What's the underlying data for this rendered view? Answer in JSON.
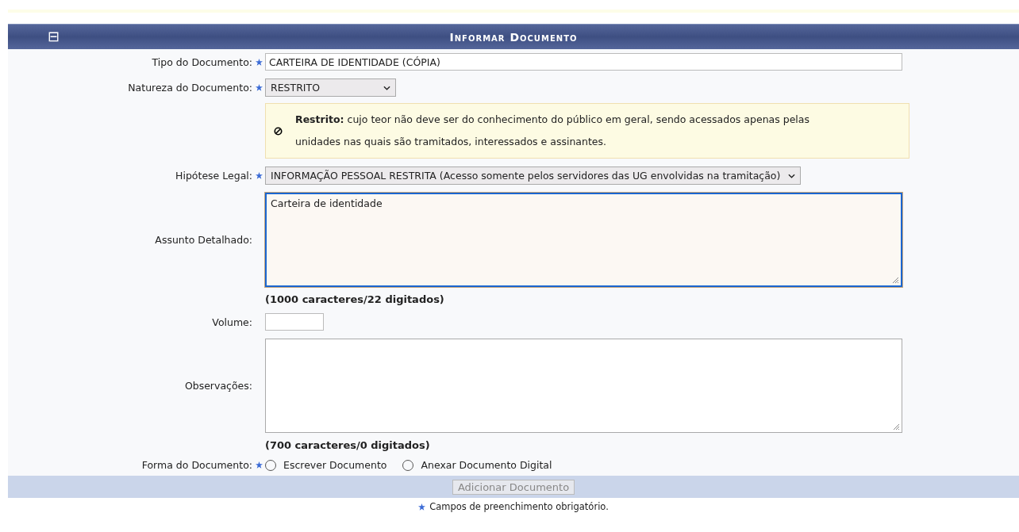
{
  "panel": {
    "title": "Informar Documento",
    "collapse_icon": "⊟"
  },
  "fields": [
    {
      "kind": "input",
      "label": "Tipo do Documento:",
      "required": true,
      "value": "CARTEIRA DE IDENTIDADE (CÓPIA)"
    },
    {
      "kind": "select",
      "label": "Natureza do Documento:",
      "required": true,
      "value": "RESTRITO"
    },
    {
      "kind": "note",
      "text": "**Restrito:** cujo teor não deve ser do conhecimento do público em geral, sendo acessados apenas pelas unidades nas quais são tramitados, interessados e assinantes."
    },
    {
      "kind": "select",
      "label": "Hipótese Legal:",
      "required": true,
      "value": "INFORMAÇÃO PESSOAL RESTRITA (Acesso somente pelos servidores das UG envolvidas na tramitação)"
    },
    {
      "kind": "textarea",
      "label": "Assunto Detalhado:",
      "required": false,
      "value": "Carteira de identidade",
      "focused": true
    },
    {
      "kind": "counter",
      "text": "(1000 caracteres/22 digitados)"
    },
    {
      "kind": "input",
      "label": "Volume:",
      "required": false
    },
    {
      "kind": "textarea",
      "label": "Observações:",
      "required": false,
      "focused": false
    },
    {
      "kind": "counter",
      "text": "(700 caracteres/0 digitados)"
    },
    {
      "kind": "radios",
      "label": "Forma do Documento:",
      "required": true,
      "options": [
        {
          "label": "Escrever Documento",
          "selected": false
        },
        {
          "label": "Anexar Documento Digital",
          "selected": false
        }
      ]
    }
  ],
  "button": {
    "label": "Adicionar Documento",
    "disabled": true
  },
  "footnote": "Campos de preenchimento obrigatório."
}
